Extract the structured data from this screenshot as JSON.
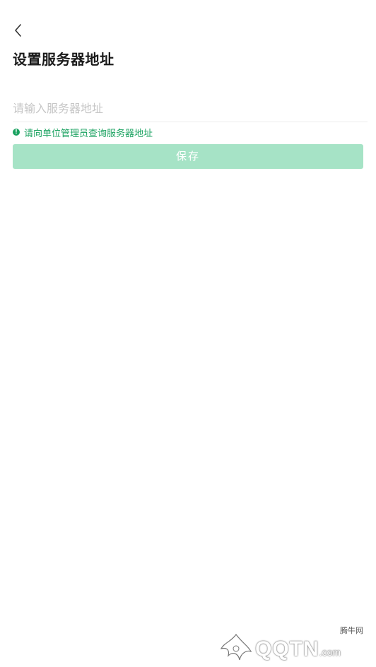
{
  "header": {
    "back_icon": "chevron-left-icon",
    "title": "设置服务器地址"
  },
  "form": {
    "server_input": {
      "value": "",
      "placeholder": "请输入服务器地址"
    },
    "hint": {
      "icon": "info-circle-icon",
      "text": "请向单位管理员查询服务器地址"
    },
    "save_label": "保存"
  },
  "watermark": {
    "tag": "腾牛网",
    "logo": "QQTN",
    "suffix": ".com"
  },
  "colors": {
    "accent": "#1aa260",
    "button_disabled": "#a6e3c6",
    "placeholder": "#c6c6c6",
    "title": "#1a1a1a"
  }
}
